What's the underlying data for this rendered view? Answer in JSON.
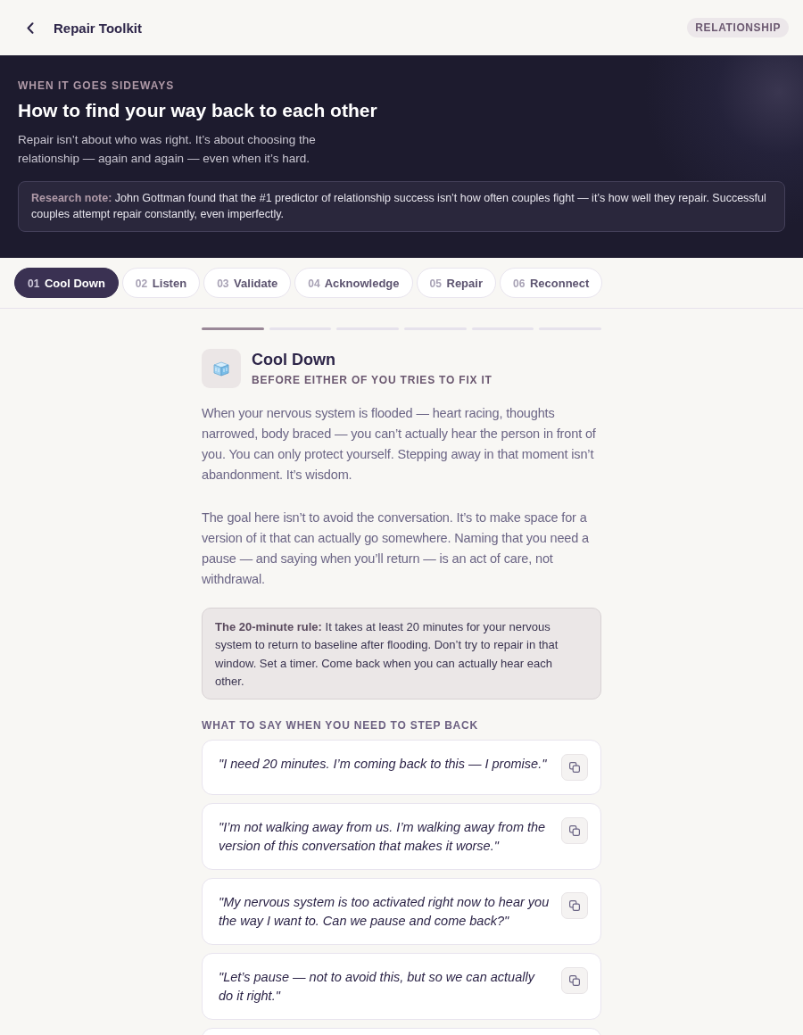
{
  "header": {
    "title": "Repair Toolkit",
    "badge": "RELATIONSHIP"
  },
  "hero": {
    "eyebrow": "WHEN IT GOES SIDEWAYS",
    "title": "How to find your way back to each other",
    "subtitle": "Repair isn’t about who was right. It’s about choosing the relationship — again and again — even when it’s hard.",
    "note": "**Research note:** John Gottman found that the #1 predictor of relationship success isn’t how often couples fight — it’s how well they repair. Successful couples attempt repair constantly, even imperfectly."
  },
  "tabs": [
    {
      "number": "01",
      "label": "Cool Down",
      "selected": true
    },
    {
      "number": "02",
      "label": "Listen",
      "selected": false
    },
    {
      "number": "03",
      "label": "Validate",
      "selected": false
    },
    {
      "number": "04",
      "label": "Acknowledge",
      "selected": false
    },
    {
      "number": "05",
      "label": "Repair",
      "selected": false
    },
    {
      "number": "06",
      "label": "Reconnect",
      "selected": false
    }
  ],
  "progress": [
    {
      "done": true
    },
    {
      "done": false
    },
    {
      "done": false
    },
    {
      "done": false
    },
    {
      "done": false
    },
    {
      "done": false
    }
  ],
  "step": {
    "title": "Cool Down",
    "subtitle": "BEFORE EITHER OF YOU TRIES TO FIX IT",
    "paragraphs": [
      "When your nervous system is flooded — heart racing, thoughts narrowed, body braced — you can’t actually hear the person in front of you. You can only protect yourself. Stepping away in that moment isn’t abandonment. It’s wisdom.",
      "The goal here isn’t to avoid the conversation. It’s to make space for a version of it that can actually go somewhere. Naming that you need a pause — and saying when you’ll return — is an act of care, not withdrawal."
    ],
    "callout": "**The 20-minute rule:** It takes at least 20 minutes for your nervous system to return to baseline after flooding. Don’t try to repair in that window. Set a timer. Come back when you can actually hear each other.",
    "phrases_heading": "WHAT TO SAY WHEN YOU NEED TO STEP BACK",
    "phrases": [
      "\"I need 20 minutes. I’m coming back to this — I promise.\"",
      "\"I’m not walking away from us. I’m walking away from the version of this conversation that makes it worse.\"",
      "\"My nervous system is too activated right now to hear you the way I want to. Can we pause and come back?\"",
      "\"Let’s pause — not to avoid this, but so we can actually do it right.\""
    ]
  }
}
